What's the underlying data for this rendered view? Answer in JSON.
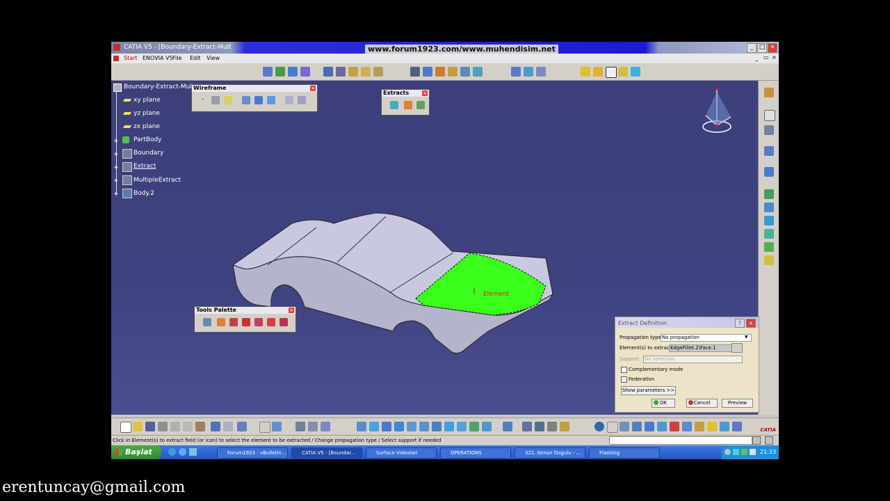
{
  "window": {
    "title": "CATIA V5 - [Boundary-Extract-Mult",
    "center_banner": "www.forum1923.com/www.muhendisim.net"
  },
  "menubar": {
    "start": "Start",
    "enovia": "ENOVIA V5",
    "file": "File",
    "edit": "Edit",
    "view": "View"
  },
  "tree": {
    "root": "Boundary-Extract-Mult",
    "items": [
      {
        "label": "xy plane"
      },
      {
        "label": "yz plane"
      },
      {
        "label": "zx plane"
      },
      {
        "label": "PartBody"
      },
      {
        "label": "Boundary"
      },
      {
        "label": "Extract"
      },
      {
        "label": "MultipleExtract"
      },
      {
        "label": "Body.2"
      }
    ]
  },
  "toolbars": {
    "wireframe": "Wireframe",
    "extracts": "Extracts",
    "tools_palette": "Tools Palette"
  },
  "viewport": {
    "element_label": "Element"
  },
  "dialog": {
    "title": "Extract Definition",
    "propagation_label": "Propagation type:",
    "propagation_value": "No propagation",
    "elements_label": "Element(s) to extract:",
    "elements_value": "EdgeFillet.2\\Face.1",
    "support_label": "Support:",
    "support_value": "No selection",
    "complementary_label": "Complementary mode",
    "federation_label": "Federation",
    "show_params": "Show parameters >>",
    "ok": "OK",
    "cancel": "Cancel",
    "preview": "Preview"
  },
  "status": {
    "message": "Click in Element(s) to extract field (or icon) to select the element to be extracted / Change propagation type / Select support if needed"
  },
  "taskbar": {
    "start": "Başlat",
    "items": [
      {
        "label": "Forum1923 - vBulletin..."
      },
      {
        "label": "CATIA V5 - [Boundar..."
      },
      {
        "label": "Surface Videolari"
      },
      {
        "label": "OPERATIONS"
      },
      {
        "label": "321. Kenan Dogulu - ..."
      },
      {
        "label": "Flashing"
      }
    ],
    "clock": "21:33"
  },
  "footer": {
    "email": "erentuncay@gmail.com"
  },
  "colors": {
    "viewport_bg": "#3f4280",
    "selected_face": "#3aff1a",
    "taskbar": "#2457c8"
  }
}
